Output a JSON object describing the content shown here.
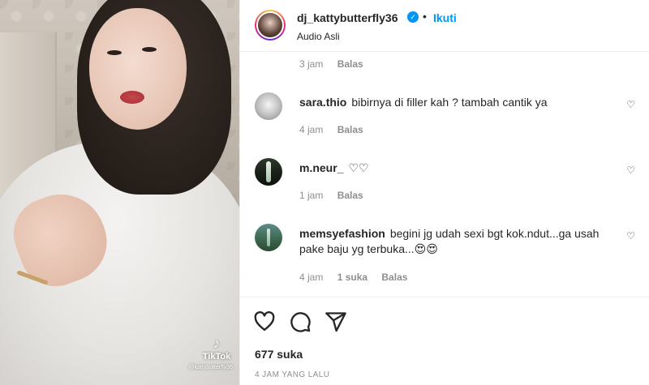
{
  "media": {
    "watermark_app": "TikTok",
    "watermark_user": "@kattybutterfly36"
  },
  "header": {
    "username": "dj_kattybutterfly36",
    "separator": "•",
    "follow_label": "Ikuti",
    "audio_label": "Audio Asli",
    "verified": true
  },
  "comments": [
    {
      "username": "",
      "text": "",
      "time": "3 jam",
      "likes": "",
      "reply": "Balas"
    },
    {
      "username": "sara.thio",
      "text": "bibirnya di filler kah ? tambah cantik ya",
      "time": "4 jam",
      "likes": "",
      "reply": "Balas"
    },
    {
      "username": "m.neur_",
      "text": "♡♡",
      "time": "1 jam",
      "likes": "",
      "reply": "Balas"
    },
    {
      "username": "memsyefashion",
      "text": "begini jg udah sexi bgt kok.ndut...ga usah pake baju yg terbuka...😍😍",
      "time": "4 jam",
      "likes": "1 suka",
      "reply": "Balas"
    }
  ],
  "actions": {
    "icons": [
      "heart-icon",
      "comment-icon",
      "share-icon"
    ],
    "likes_count": "677 suka",
    "timestamp": "4 JAM YANG LALU"
  },
  "colors": {
    "accent": "#0095f6",
    "text": "#262626",
    "muted": "#8e8e8e",
    "divider": "#efefef"
  }
}
